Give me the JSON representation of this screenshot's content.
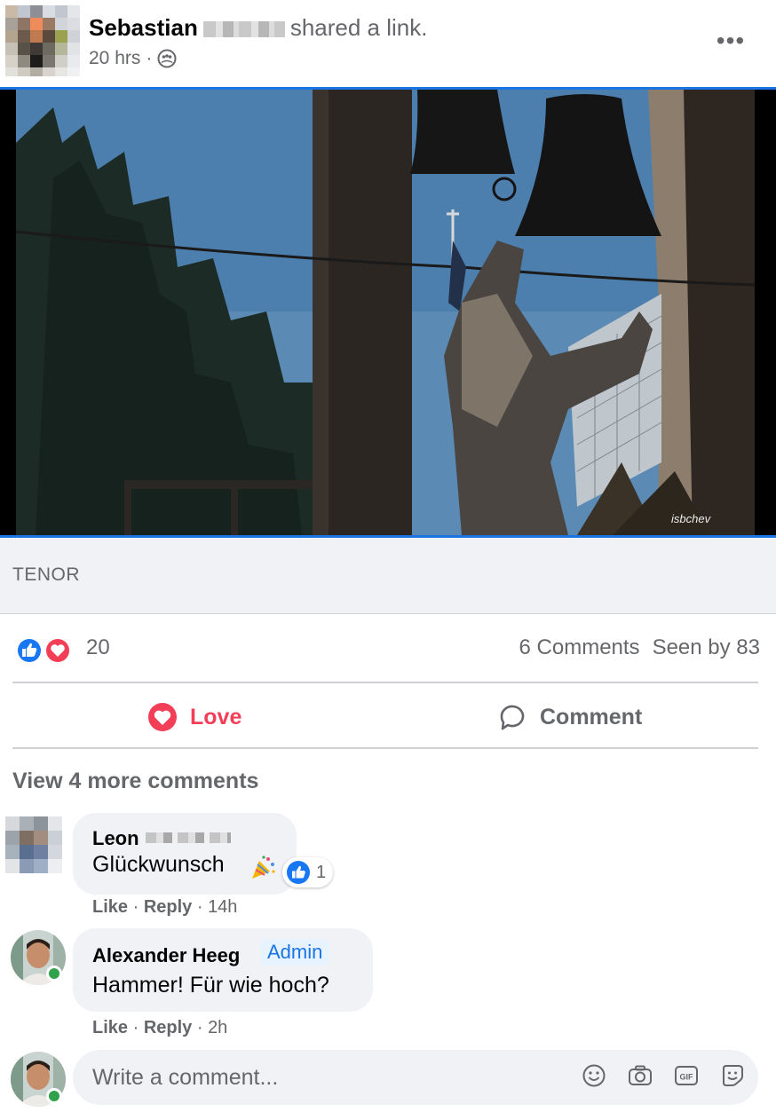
{
  "post": {
    "author": "Sebastian",
    "shared_text": "shared a link.",
    "time": "20 hrs",
    "separator": "·",
    "more_label": "•••"
  },
  "media": {
    "watermark": "isbchev"
  },
  "link_preview": {
    "domain": "TENOR"
  },
  "reactions": {
    "count": "20",
    "comments": "6 Comments",
    "seen_by": "Seen by 83"
  },
  "actions": {
    "love": "Love",
    "comment": "Comment"
  },
  "comments": {
    "view_more": "View 4 more comments",
    "items": [
      {
        "name": "Leon",
        "text": "Glückwunsch",
        "reaction_count": "1",
        "like": "Like",
        "reply": "Reply",
        "time": "14h"
      },
      {
        "name": "Alexander Heeg",
        "badge": "Admin",
        "text": "Hammer! Für wie hoch?",
        "like": "Like",
        "reply": "Reply",
        "time": "2h"
      }
    ]
  },
  "composer": {
    "placeholder": "Write a comment..."
  },
  "colors": {
    "accent": "#1b74e4",
    "love": "#f33e58",
    "secondary_text": "#65676b",
    "bubble": "#f0f2f5",
    "online": "#31a24c"
  }
}
